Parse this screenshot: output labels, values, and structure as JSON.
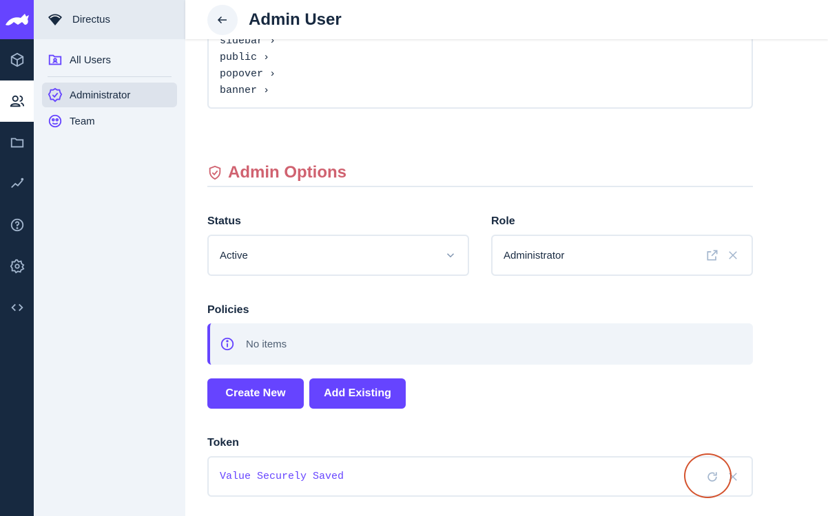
{
  "project": {
    "name": "Directus"
  },
  "header": {
    "title": "Admin User"
  },
  "navigation": {
    "items": [
      {
        "label": "All Users"
      },
      {
        "label": "Administrator"
      },
      {
        "label": "Team"
      }
    ]
  },
  "json_field": {
    "lines": [
      "sidebar",
      "public",
      "popover",
      "banner"
    ]
  },
  "section": {
    "title": "Admin Options"
  },
  "status": {
    "label": "Status",
    "value": "Active"
  },
  "role": {
    "label": "Role",
    "value": "Administrator"
  },
  "policies": {
    "label": "Policies",
    "empty_text": "No items",
    "create_label": "Create New",
    "add_existing_label": "Add Existing"
  },
  "token": {
    "label": "Token",
    "value": "Value Securely Saved"
  },
  "colors": {
    "accent": "#6644ff",
    "rail": "#172940",
    "danger_title": "#d06270"
  },
  "icons": [
    "directus-logo",
    "box-icon",
    "users-icon",
    "folder-icon",
    "insights-icon",
    "help-icon",
    "gear-icon",
    "code-icon",
    "wifi-icon",
    "folder-user-icon",
    "verified-icon",
    "face-icon",
    "arrow-left-icon",
    "shield-icon",
    "chevron-down-icon",
    "open-in-new-icon",
    "close-icon",
    "info-icon",
    "refresh-icon"
  ]
}
